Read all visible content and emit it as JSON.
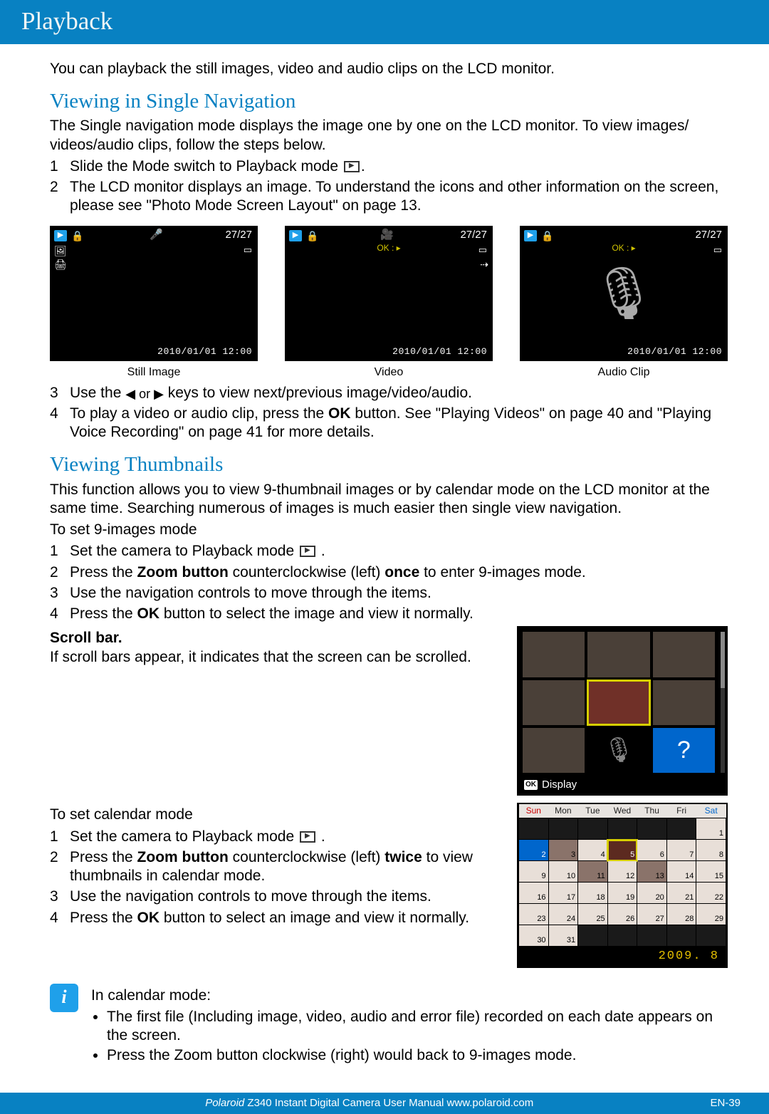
{
  "page_title": "Playback",
  "intro": "You can playback the still images, video and audio clips on the LCD monitor.",
  "section1": {
    "heading": "Viewing in Single Navigation",
    "desc": "The Single navigation mode displays the image one by one on the LCD monitor. To view images/ videos/audio clips, follow the steps below.",
    "steps_a": [
      {
        "n": "1",
        "t_pre": "Slide the Mode switch to Playback mode ",
        "t_post": "."
      },
      {
        "n": "2",
        "t": "The LCD monitor displays an image. To understand the icons and other information on the screen, please see \"Photo Mode Screen Layout\" on page 13."
      }
    ],
    "thumbs": [
      {
        "caption": "Still Image",
        "count": "27/27",
        "ts": "2010/01/01 12:00",
        "icon": "mic"
      },
      {
        "caption": "Video",
        "count": "27/27",
        "ts": "2010/01/01 12:00",
        "icon": "cam",
        "ok": "OK : ▸"
      },
      {
        "caption": "Audio Clip",
        "count": "27/27",
        "ts": "2010/01/01 12:00",
        "ok": "OK : ▸",
        "big": true
      }
    ],
    "steps_b": [
      {
        "n": "3",
        "t_pre": "Use the ",
        "arr": "◀   or  ▶",
        "t_post": "  keys to view next/previous image/video/audio."
      },
      {
        "n": "4",
        "t": "To play a video or audio clip, press the OK button. See \"Playing Videos\" on page 40 and \"Playing Voice Recording\" on page 41 for more details.",
        "bold": "OK"
      }
    ]
  },
  "section2": {
    "heading": "Viewing Thumbnails",
    "desc": "This function allows you to view 9-thumbnail images or by calendar mode on the LCD monitor at the same time. Searching numerous of images is much easier then single view navigation.",
    "mode9_label": "To set 9-images mode",
    "mode9": [
      {
        "n": "1",
        "t_pre": "Set the camera to Playback mode  ",
        "t_post": " ."
      },
      {
        "n": "2",
        "t": "Press the Zoom button counterclockwise (left) once to enter 9-images mode."
      },
      {
        "n": "3",
        "t": "Use the navigation controls to move through the items."
      },
      {
        "n": "4",
        "t": "Press the OK button to select the image and view it normally."
      }
    ],
    "scroll_head": "Scroll bar.",
    "scroll_txt": "If scroll bars appear, it indicates that the screen can be scrolled.",
    "thumb9_display": "Display",
    "cal_label": "To set calendar mode",
    "cal_steps": [
      {
        "n": "1",
        "t_pre": "Set the camera to Playback mode ",
        "t_post": " ."
      },
      {
        "n": "2",
        "t": "Press the Zoom button counterclockwise (left) twice to view thumbnails in calendar mode."
      },
      {
        "n": "3",
        "t": "Use the navigation controls to move through the items."
      },
      {
        "n": "4",
        "t": "Press the OK button to select an image and view it normally."
      }
    ],
    "calendar": {
      "days": [
        "Sun",
        "Mon",
        "Tue",
        "Wed",
        "Thu",
        "Fri",
        "Sat"
      ],
      "date_label": "2009. 8"
    }
  },
  "info": {
    "heading": "In calendar mode:",
    "bullets": [
      "The first file (Including image, video, audio and error file) recorded on each date appears on the screen.",
      "Press the Zoom button clockwise (right) would back to 9-images mode."
    ]
  },
  "footer": {
    "center_italic": "Polaroid",
    "center_rest": " Z340 Instant Digital Camera User Manual www.polaroid.com",
    "right": "EN-39"
  }
}
